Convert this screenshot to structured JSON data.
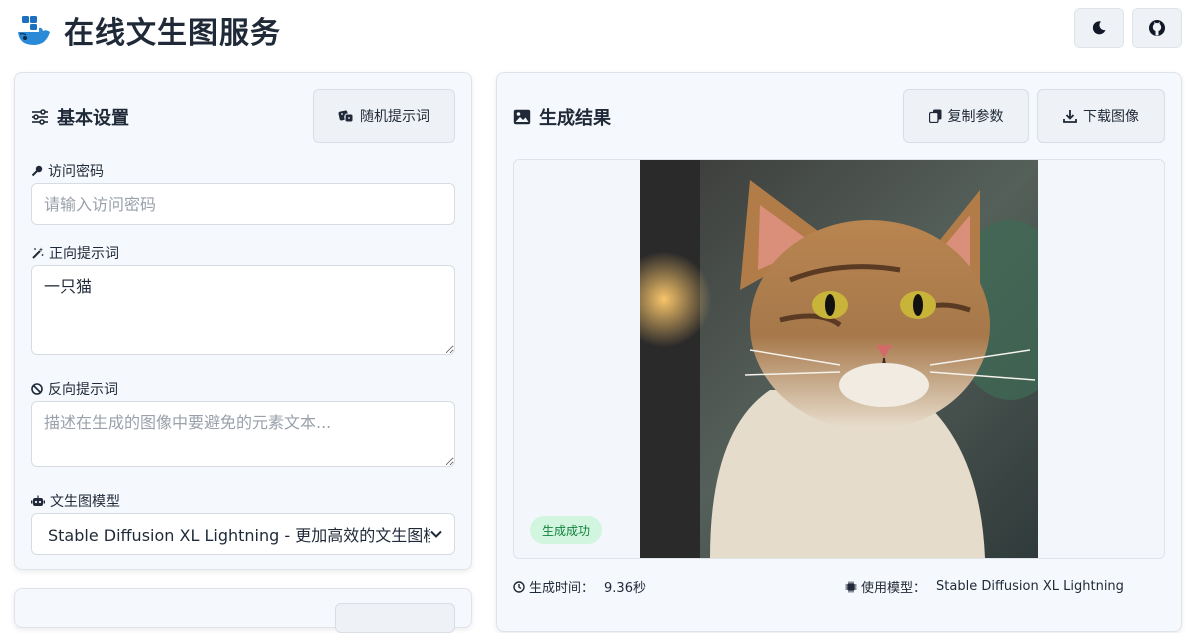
{
  "header": {
    "title": "在线文生图服务",
    "logo_icon": "docker-whale-icon",
    "theme_icon": "moon-icon",
    "github_icon": "github-icon"
  },
  "settings": {
    "title": "基本设置",
    "random_button": "随机提示词",
    "password": {
      "label": "访问密码",
      "placeholder": "请输入访问密码",
      "value": ""
    },
    "positive": {
      "label": "正向提示词",
      "value": "一只猫"
    },
    "negative": {
      "label": "反向提示词",
      "placeholder": "描述在生成的图像中要避免的元素文本...",
      "value": ""
    },
    "model": {
      "label": "文生图模型",
      "selected": "Stable Diffusion XL Lightning - 更加高效的文生图模型"
    }
  },
  "result": {
    "title": "生成结果",
    "copy_button": "复制参数",
    "download_button": "下载图像",
    "status_badge": "生成成功",
    "time_label": "生成时间：",
    "time_value": "9.36秒",
    "model_label": "使用模型：",
    "model_value": "Stable Diffusion XL Lightning"
  },
  "colors": {
    "accent": "#1f2937",
    "success_bg": "#d1f5df",
    "success_text": "#15803d",
    "card_bg": "#f5f8fc"
  }
}
